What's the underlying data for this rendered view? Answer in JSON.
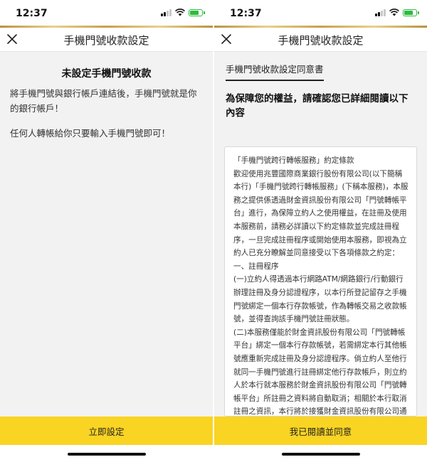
{
  "status_bar": {
    "time": "12:37"
  },
  "left_screen": {
    "nav_title": "手機門號收款設定",
    "heading": "未設定手機門號收款",
    "paragraphs": [
      "將手機門號與銀行帳戶連結後，手機門號就是你的銀行帳戶！",
      "任何人轉帳給你只要輸入手機門號即可！"
    ],
    "button_label": "立即設定"
  },
  "right_screen": {
    "nav_title": "手機門號收款設定",
    "tab_label": "手機門號收款設定同意書",
    "heading": "為保障您的權益，請確認您已詳細閱讀以下內容",
    "terms": [
      "「手機門號跨行轉帳服務」約定條款",
      "歡迎使用兆豐國際商業銀行股份有限公司(以下簡稱本行)「手機門號跨行轉帳服務」(下稱本服務)，本服務之提供係透過財金資訊股份有限公司「門號轉帳平台」進行，為保障立約人之使用權益，在註冊及使用本服務前，請務必詳讀以下約定條款並完成註冊程序，一旦完成註冊程序或開始使用本服務，即視為立約人已充分瞭解並同意接受以下各項條款之約定：",
      "一、註冊程序",
      "(一)立約人得透過本行網路ATM/網路銀行/行動銀行辦理註冊及身分認證程序，以本行所登記留存之手機門號綁定一個本行存款帳號，作為轉帳交易之收款帳號，並得查詢該手機門號註冊狀態。",
      "(二)本服務僅能於財金資訊股份有限公司「門號轉帳平台」綁定一個本行存款帳號，若需綁定本行其他帳號應重新完成註冊及身分認證程序。倘立約人至他行就同一手機門號進行註冊綁定他行存款帳戶，則立約人於本行就本服務於財金資訊股份有限公司「門號轉帳平台」所註冊之資料將自動取消；相關於本行取消註冊之資訊，本行將於接獲財金資訊股份有限公司通知後"
    ],
    "button_label": "我已閱讀並同意"
  }
}
